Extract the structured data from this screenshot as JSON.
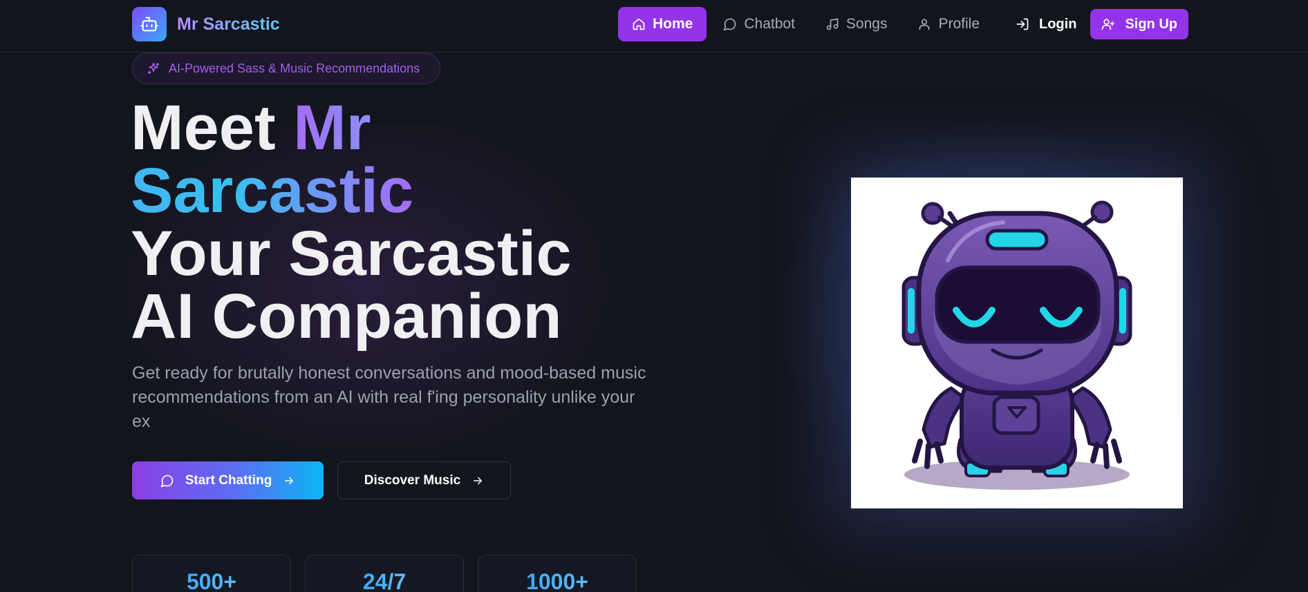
{
  "nav": {
    "brand": "Mr Sarcastic",
    "links": [
      {
        "label": "Home",
        "icon": "home-icon",
        "active": true
      },
      {
        "label": "Chatbot",
        "icon": "chat-icon",
        "active": false
      },
      {
        "label": "Songs",
        "icon": "music-icon",
        "active": false
      },
      {
        "label": "Profile",
        "icon": "user-icon",
        "active": false
      }
    ],
    "login": "Login",
    "signup": "Sign Up"
  },
  "hero": {
    "badge": "AI-Powered Sass & Music Recommendations",
    "headline_plain_1": "Meet ",
    "headline_grad_1": "Mr",
    "headline_grad_2": "Sarcastic",
    "headline_line_3": "Your Sarcastic",
    "headline_line_4": "AI Companion",
    "subtext": "Get ready for brutally honest conversations and mood-based music recommendations from an AI with real f'ing personality unlike your ex",
    "primary_cta": "Start Chatting",
    "secondary_cta": "Discover Music"
  },
  "stats": [
    "500+",
    "24/7",
    "1000+"
  ],
  "colors": {
    "background": "#13151d",
    "accent_purple": "#9333ea",
    "accent_cyan": "#0bb6f5",
    "text_muted": "#9aa1ad"
  }
}
